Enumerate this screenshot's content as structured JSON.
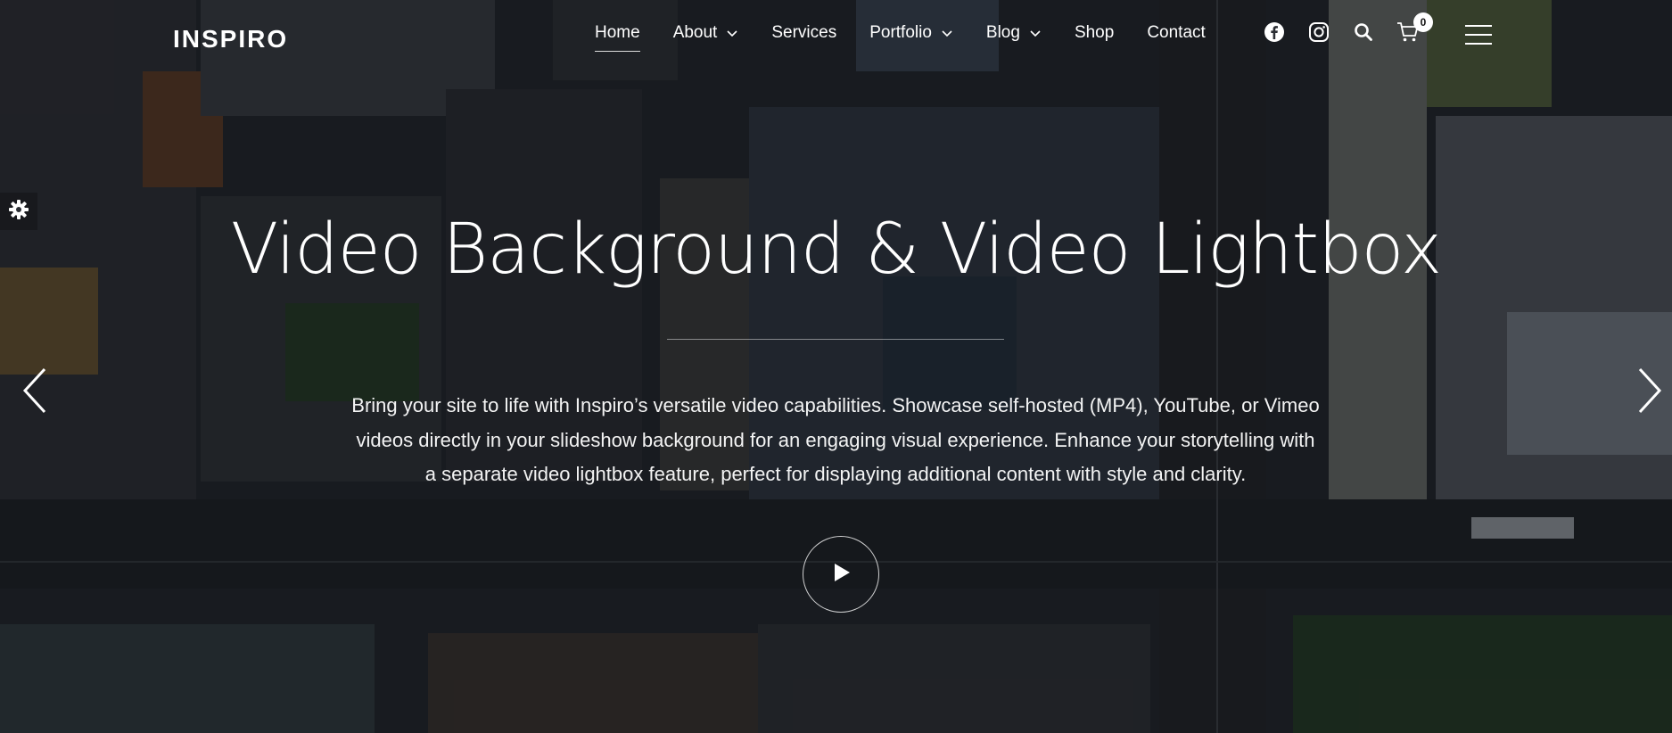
{
  "brand": {
    "logo": "INSPIRO"
  },
  "nav": {
    "items": [
      {
        "label": "Home",
        "active": true,
        "has_dropdown": false
      },
      {
        "label": "About",
        "active": false,
        "has_dropdown": true
      },
      {
        "label": "Services",
        "active": false,
        "has_dropdown": false
      },
      {
        "label": "Portfolio",
        "active": false,
        "has_dropdown": true
      },
      {
        "label": "Blog",
        "active": false,
        "has_dropdown": true
      },
      {
        "label": "Shop",
        "active": false,
        "has_dropdown": false
      },
      {
        "label": "Contact",
        "active": false,
        "has_dropdown": false
      }
    ]
  },
  "header_icons": [
    "facebook-icon",
    "instagram-icon",
    "search-icon",
    "cart-icon"
  ],
  "cart": {
    "count": "0"
  },
  "hero": {
    "title": "Video Background & Video Lightbox",
    "lines": [
      "Bring your site to life with Inspiro’s versatile video capabilities. Showcase self-hosted (MP4), YouTube, or Vimeo",
      "videos directly in your slideshow background for an engaging visual experience. Enhance your storytelling with",
      "a separate video lightbox feature, perfect for displaying additional content with style and clarity."
    ]
  },
  "controls": {
    "prev": "chevron-left-icon",
    "next": "chevron-right-icon",
    "play": "play-icon",
    "settings": "gear-icon",
    "menu": "hamburger-menu-icon"
  },
  "colors": {
    "text": "#ffffff",
    "overlay": "#0a0c10",
    "background": "#1b1d22"
  }
}
